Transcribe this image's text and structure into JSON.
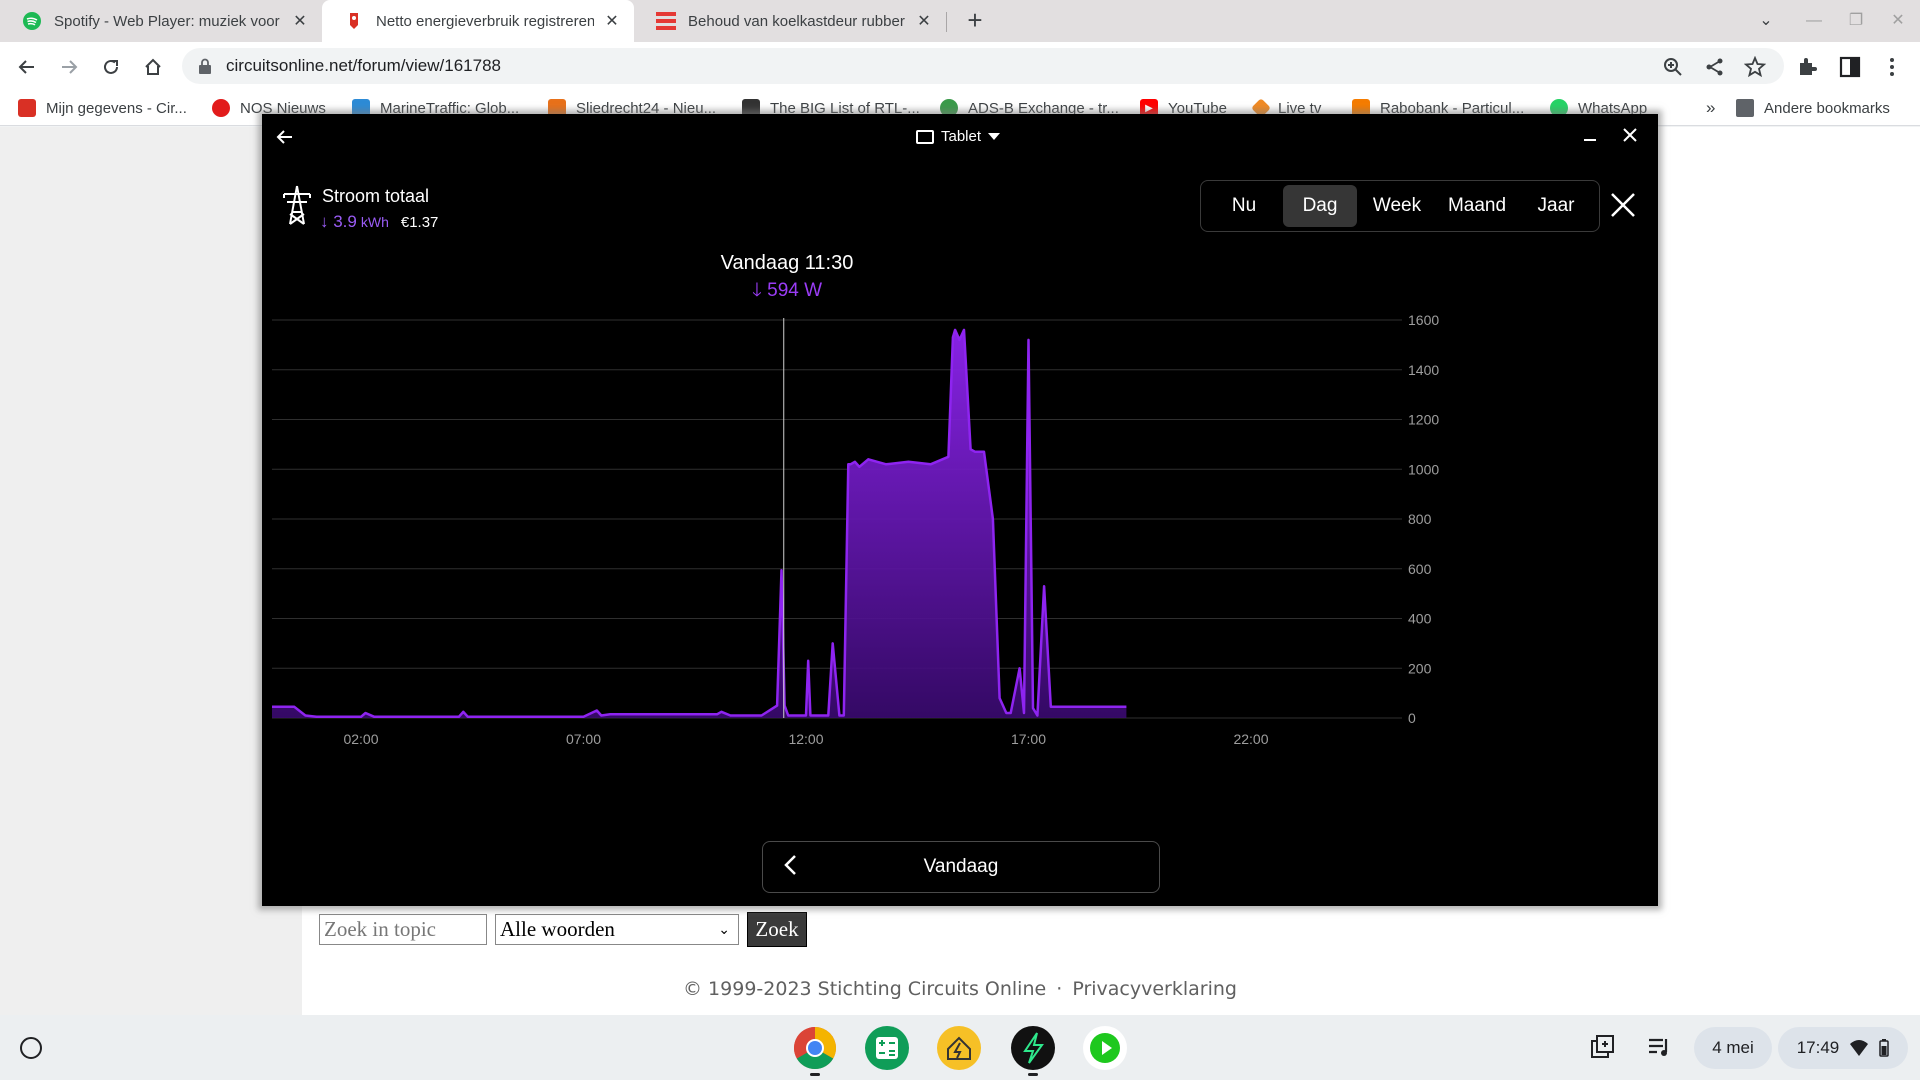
{
  "browser": {
    "tabs": [
      {
        "title": "Spotify - Web Player: muziek voor iedereen",
        "favicon": "spotify-icon",
        "active": false
      },
      {
        "title": "Netto energieverbruik registreren",
        "favicon": "circuitsonline-icon",
        "active": true
      },
      {
        "title": "Behoud van koelkastdeur rubber",
        "favicon": "stripes-icon",
        "active": false
      }
    ],
    "url": "circuitsonline.net/forum/view/161788",
    "bookmarks": [
      {
        "label": "Mijn gegevens - Cir...",
        "icon": "circuitsonline-icon",
        "color": "#d93025"
      },
      {
        "label": "NOS Nieuws",
        "icon": "nos-icon",
        "color": "#e21b1b"
      },
      {
        "label": "MarineTraffic: Glob...",
        "icon": "marinetraffic-icon",
        "color": "#2d8bd6"
      },
      {
        "label": "Sliedrecht24 - Nieu...",
        "icon": "sliedrecht24-icon",
        "color": "#e8711a"
      },
      {
        "label": "The BIG List of RTL-...",
        "icon": "rtl-icon",
        "color": "#333333"
      },
      {
        "label": "ADS-B Exchange - tr...",
        "icon": "adsb-icon",
        "color": "#3a9a4a"
      },
      {
        "label": "YouTube",
        "icon": "youtube-icon",
        "color": "#ff0000"
      },
      {
        "label": "Live tv",
        "icon": "livetv-icon",
        "color": "#f08a24"
      },
      {
        "label": "Rabobank - Particul...",
        "icon": "rabobank-icon",
        "color": "#f57c00"
      },
      {
        "label": "WhatsApp",
        "icon": "whatsapp-icon",
        "color": "#25d366"
      }
    ],
    "more_bookmarks": "»",
    "other_bookmarks": "Andere bookmarks"
  },
  "app": {
    "mode_label": "Tablet",
    "meter_title": "Stroom totaal",
    "meter_energy": "↓ 3.9",
    "meter_energy_unit": "kWh",
    "meter_cost": "€1.37",
    "periods": [
      "Nu",
      "Dag",
      "Week",
      "Maand",
      "Jaar"
    ],
    "active_period": "Dag",
    "tooltip_time": "Vandaag 11:30",
    "tooltip_value": "594 W",
    "nav_label": "Vandaag",
    "accent_color": "#8e24f0"
  },
  "chart_data": {
    "type": "area",
    "x_unit": "hour of day",
    "xlim": [
      0,
      24
    ],
    "x_ticks": [
      "02:00",
      "07:00",
      "12:00",
      "17:00",
      "22:00"
    ],
    "x_tick_values": [
      2,
      7,
      12,
      17,
      22
    ],
    "ylim": [
      0,
      1600
    ],
    "y_ticks": [
      0,
      200,
      400,
      600,
      800,
      1000,
      1200,
      1400,
      1600
    ],
    "cursor_x": 11.5,
    "series": [
      {
        "x": [
          0,
          0.5,
          0.75,
          1.0,
          2.0,
          2.1,
          2.3,
          4.2,
          4.3,
          4.4,
          7.0,
          7.3,
          7.4,
          7.6,
          8.0,
          10.0,
          10.1,
          10.3,
          11.0,
          11.35,
          11.45,
          11.52,
          11.6,
          11.7,
          12.0,
          12.05,
          12.1,
          12.2,
          12.5,
          12.6,
          12.75,
          12.85,
          12.95,
          13.0,
          13.1,
          13.2,
          13.4,
          13.8,
          14.3,
          14.8,
          15.2,
          15.3,
          15.35,
          15.45,
          15.55,
          15.7,
          15.8,
          15.85,
          16.0,
          16.2,
          16.35,
          16.5,
          16.6,
          16.8,
          16.9,
          17.0,
          17.1,
          17.2,
          17.35,
          17.5,
          17.65,
          17.8,
          17.95,
          18.0,
          18.2,
          18.4,
          18.5,
          18.6,
          18.8,
          19.2
        ],
        "y": [
          45,
          45,
          10,
          5,
          5,
          20,
          5,
          5,
          25,
          5,
          5,
          30,
          10,
          15,
          15,
          15,
          25,
          10,
          10,
          50,
          594,
          50,
          10,
          10,
          10,
          230,
          10,
          10,
          10,
          300,
          10,
          10,
          1020,
          1020,
          1030,
          1010,
          1040,
          1020,
          1030,
          1020,
          1050,
          1530,
          1560,
          1520,
          1560,
          1080,
          1070,
          1070,
          1070,
          800,
          80,
          20,
          20,
          200,
          20,
          1520,
          40,
          10,
          530,
          45,
          45,
          45,
          45,
          45,
          45,
          45,
          45,
          45,
          45,
          45
        ]
      }
    ]
  },
  "page": {
    "search_placeholder": "Zoek in topic",
    "search_mode": "Alle woorden",
    "search_button": "Zoek",
    "footer_copyright": "© 1999-2023 Stichting Circuits Online",
    "footer_sep": "·",
    "footer_privacy": "Privacyverklaring"
  },
  "shelf": {
    "date": "4 mei",
    "time": "17:49"
  }
}
